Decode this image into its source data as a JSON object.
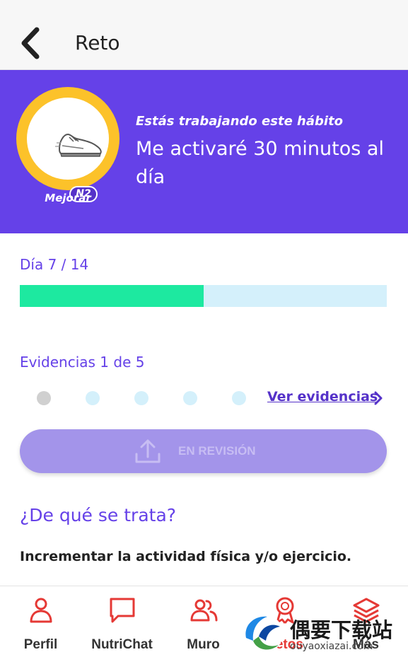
{
  "header": {
    "title": "Reto",
    "back_icon": "chevron-left-icon"
  },
  "hero": {
    "kicker": "Estás trabajando este hábito",
    "habit": "Me activaré 30 minutos al día",
    "level_badge": "N2",
    "level_label": "Mejorar",
    "badge_icon": "sneaker-icon",
    "colors": {
      "background": "#6541e8",
      "ring": "#fcc22a"
    }
  },
  "progress": {
    "label": "Día 7 / 14",
    "current": 7,
    "total": 14,
    "fill_color": "#1de9a0",
    "track_color": "#d4f0fb"
  },
  "evidence": {
    "label": "Evidencias 1 de 5",
    "submitted": 1,
    "total": 5,
    "link": "Ver evidencias"
  },
  "review_button": {
    "label": "EN REVISIÓN",
    "icon": "upload-icon"
  },
  "about": {
    "title": "¿De qué se trata?",
    "text": "Incrementar la actividad física y/o ejercicio."
  },
  "nav": {
    "items": [
      {
        "label": "Perfil",
        "icon": "person-icon"
      },
      {
        "label": "NutriChat",
        "icon": "chat-bubble-icon"
      },
      {
        "label": "Muro",
        "icon": "people-icon"
      },
      {
        "label": "Retos",
        "icon": "medal-icon"
      },
      {
        "label": "Más",
        "icon": "layers-icon"
      }
    ],
    "accent": "#e53935"
  },
  "watermark": {
    "text": "偶要下载站",
    "url": "ouyaoxiazai.com"
  }
}
